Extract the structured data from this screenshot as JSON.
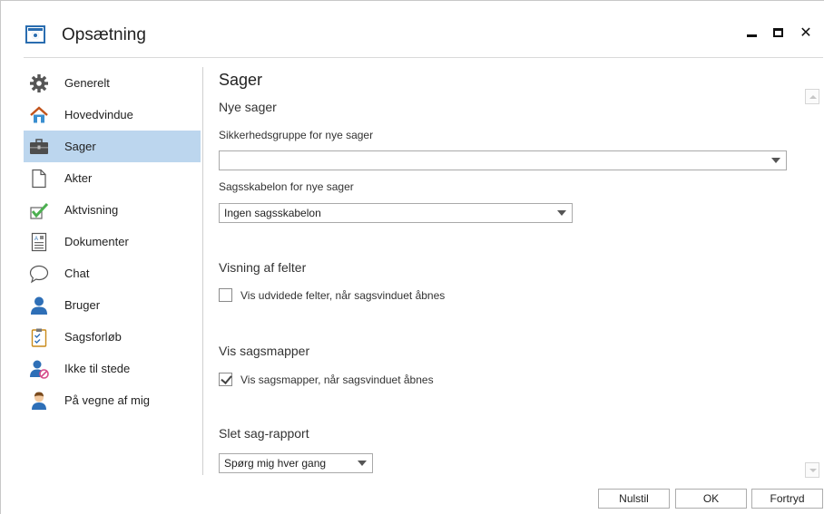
{
  "window": {
    "title": "Opsætning",
    "minimize_icon": "minimize-icon",
    "maximize_icon": "maximize-icon",
    "close_glyph": "✕"
  },
  "sidebar": {
    "items": [
      {
        "label": "Generelt",
        "icon": "gear-icon"
      },
      {
        "label": "Hovedvindue",
        "icon": "home-icon"
      },
      {
        "label": "Sager",
        "icon": "briefcase-icon",
        "selected": true
      },
      {
        "label": "Akter",
        "icon": "blank-document-icon"
      },
      {
        "label": "Aktvisning",
        "icon": "checkmark-icon"
      },
      {
        "label": "Dokumenter",
        "icon": "text-document-icon"
      },
      {
        "label": "Chat",
        "icon": "chat-bubble-icon"
      },
      {
        "label": "Bruger",
        "icon": "user-icon"
      },
      {
        "label": "Sagsforløb",
        "icon": "clipboard-icon"
      },
      {
        "label": "Ikke til stede",
        "icon": "user-away-icon"
      },
      {
        "label": "På vegne af mig",
        "icon": "user-delegate-icon"
      }
    ]
  },
  "main": {
    "title": "Sager",
    "new_cases": {
      "heading": "Nye sager",
      "security_group_label": "Sikkerhedsgruppe for nye sager",
      "security_group_value": "",
      "template_label": "Sagsskabelon for nye sager",
      "template_value": "Ingen sagsskabelon"
    },
    "field_display": {
      "heading": "Visning af felter",
      "checkbox_label": "Vis udvidede felter, når sagsvinduet åbnes",
      "checked": false
    },
    "case_folders": {
      "heading": "Vis sagsmapper",
      "checkbox_label": "Vis sagsmapper, når sagsvinduet åbnes",
      "checked": true
    },
    "delete_report": {
      "heading": "Slet sag-rapport",
      "value": "Spørg mig hver gang"
    }
  },
  "footer": {
    "reset_label": "Nulstil",
    "ok_label": "OK",
    "cancel_label": "Fortryd"
  },
  "colors": {
    "selected_bg": "#bcd6ee",
    "accent": "#2a6db0"
  }
}
